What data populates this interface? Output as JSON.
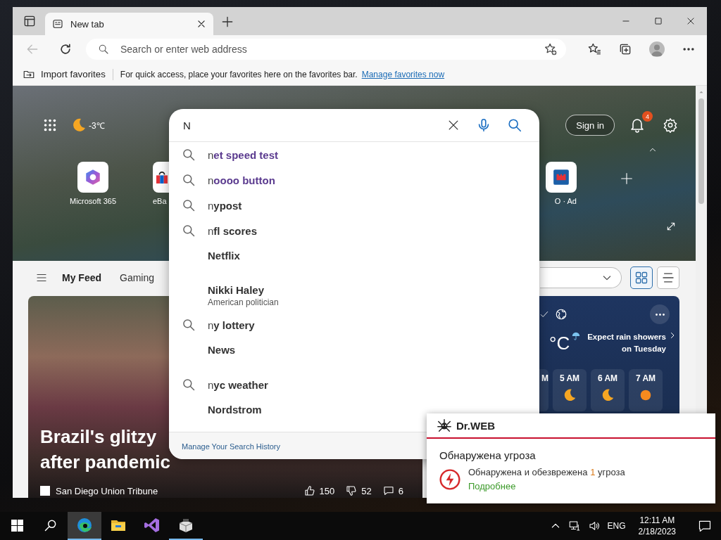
{
  "window": {
    "tab": {
      "title": "New tab",
      "selected": true
    }
  },
  "address_bar": {
    "placeholder": "Search or enter web address",
    "back_disabled": true
  },
  "favorites_bar": {
    "import_label": "Import favorites",
    "message": "For quick access, place your favorites here on the favorites bar.",
    "link": "Manage favorites now"
  },
  "hero": {
    "weather": "-3℃",
    "sign_in": "Sign in",
    "notification_count": "4",
    "tiles_left": [
      {
        "kind": "suite",
        "label": "Microsoft 365"
      },
      {
        "kind": "shop",
        "label": "eBa"
      }
    ],
    "tiles_right": [
      {
        "kind": "ad",
        "label": "O · Ad"
      },
      {
        "kind": "add"
      }
    ]
  },
  "feed": {
    "tabs": [
      {
        "label": "My Feed",
        "selected": true
      },
      {
        "label": "Gaming",
        "selected": false
      }
    ],
    "views": [
      {
        "kind": "grid",
        "selected": true
      },
      {
        "kind": "list",
        "selected": false
      }
    ]
  },
  "news_card": {
    "title_lines": [
      "Brazil's glitzy",
      "after pandemic"
    ],
    "source": "San Diego Union Tribune",
    "likes": "150",
    "dislikes": "52",
    "comments": "6"
  },
  "weather_card": {
    "unit": "°C",
    "forecast": "Expect rain showers on Tuesday",
    "hours": [
      {
        "time": "M"
      },
      {
        "time": "5 AM",
        "kind": "moon"
      },
      {
        "time": "6 AM",
        "kind": "moon"
      },
      {
        "time": "7 AM",
        "kind": "sun"
      }
    ]
  },
  "search": {
    "query": "N",
    "footer_link": "Manage Your Search History",
    "suggestions": [
      {
        "kind": "query",
        "text": "n**et speed test**",
        "visited": true
      },
      {
        "kind": "query",
        "text": "n**oooo button**",
        "visited": true
      },
      {
        "kind": "query",
        "text": "n**ypost**",
        "visited": false
      },
      {
        "kind": "query",
        "text": "n**fl scores**",
        "visited": false
      },
      {
        "kind": "entity",
        "text": "Netflix"
      },
      {
        "kind": "entity",
        "text": "Nikki Haley",
        "subtitle": "American politician"
      },
      {
        "kind": "query",
        "text": "n**y lottery**",
        "visited": false
      },
      {
        "kind": "entity",
        "text": "News"
      },
      {
        "kind": "query",
        "text": "n**yc weather**",
        "visited": false
      },
      {
        "kind": "entity",
        "text": "Nordstrom"
      }
    ]
  },
  "notification": {
    "brand": "Dr.WEB",
    "title": "Обнаружена угроза",
    "message_start": "Обнаружена и обезврежена",
    "count": "1",
    "message_end": "угроза",
    "link": "Подробнее"
  },
  "taskbar": {
    "apps": [
      {
        "kind": "browser",
        "selected": true,
        "running": true
      },
      {
        "kind": "folder",
        "selected": false,
        "running": false
      },
      {
        "kind": "ide",
        "selected": false,
        "running": false
      },
      {
        "kind": "app",
        "selected": false,
        "running": true
      }
    ],
    "language": "ENG",
    "time": "12:11 AM",
    "date": "2/18/2023"
  }
}
